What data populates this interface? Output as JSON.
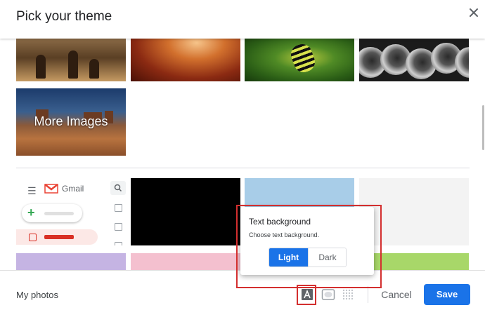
{
  "dialog": {
    "title": "Pick your theme",
    "close_icon": "close-icon"
  },
  "themes": {
    "photos": [
      "chess",
      "canyon",
      "caterpillar",
      "pipes"
    ],
    "more_images_label": "More Images",
    "swatches": {
      "black": "#000000",
      "light_blue": "#a8cde8",
      "light_gray": "#f3f3f3",
      "lavender": "#c5b4e3",
      "pink": "#f4c0cf",
      "lime": "#a8d769"
    },
    "default_preview": {
      "app_label": "Gmail"
    }
  },
  "text_background_popup": {
    "title": "Text background",
    "subtitle": "Choose text background.",
    "options": [
      "Light",
      "Dark"
    ],
    "selected": "Light"
  },
  "footer": {
    "my_photos": "My photos",
    "icons": [
      "text-background-icon",
      "vignette-icon",
      "blur-icon"
    ],
    "cancel": "Cancel",
    "save": "Save"
  },
  "colors": {
    "accent": "#1a73e8",
    "highlight": "#d32f2f"
  }
}
